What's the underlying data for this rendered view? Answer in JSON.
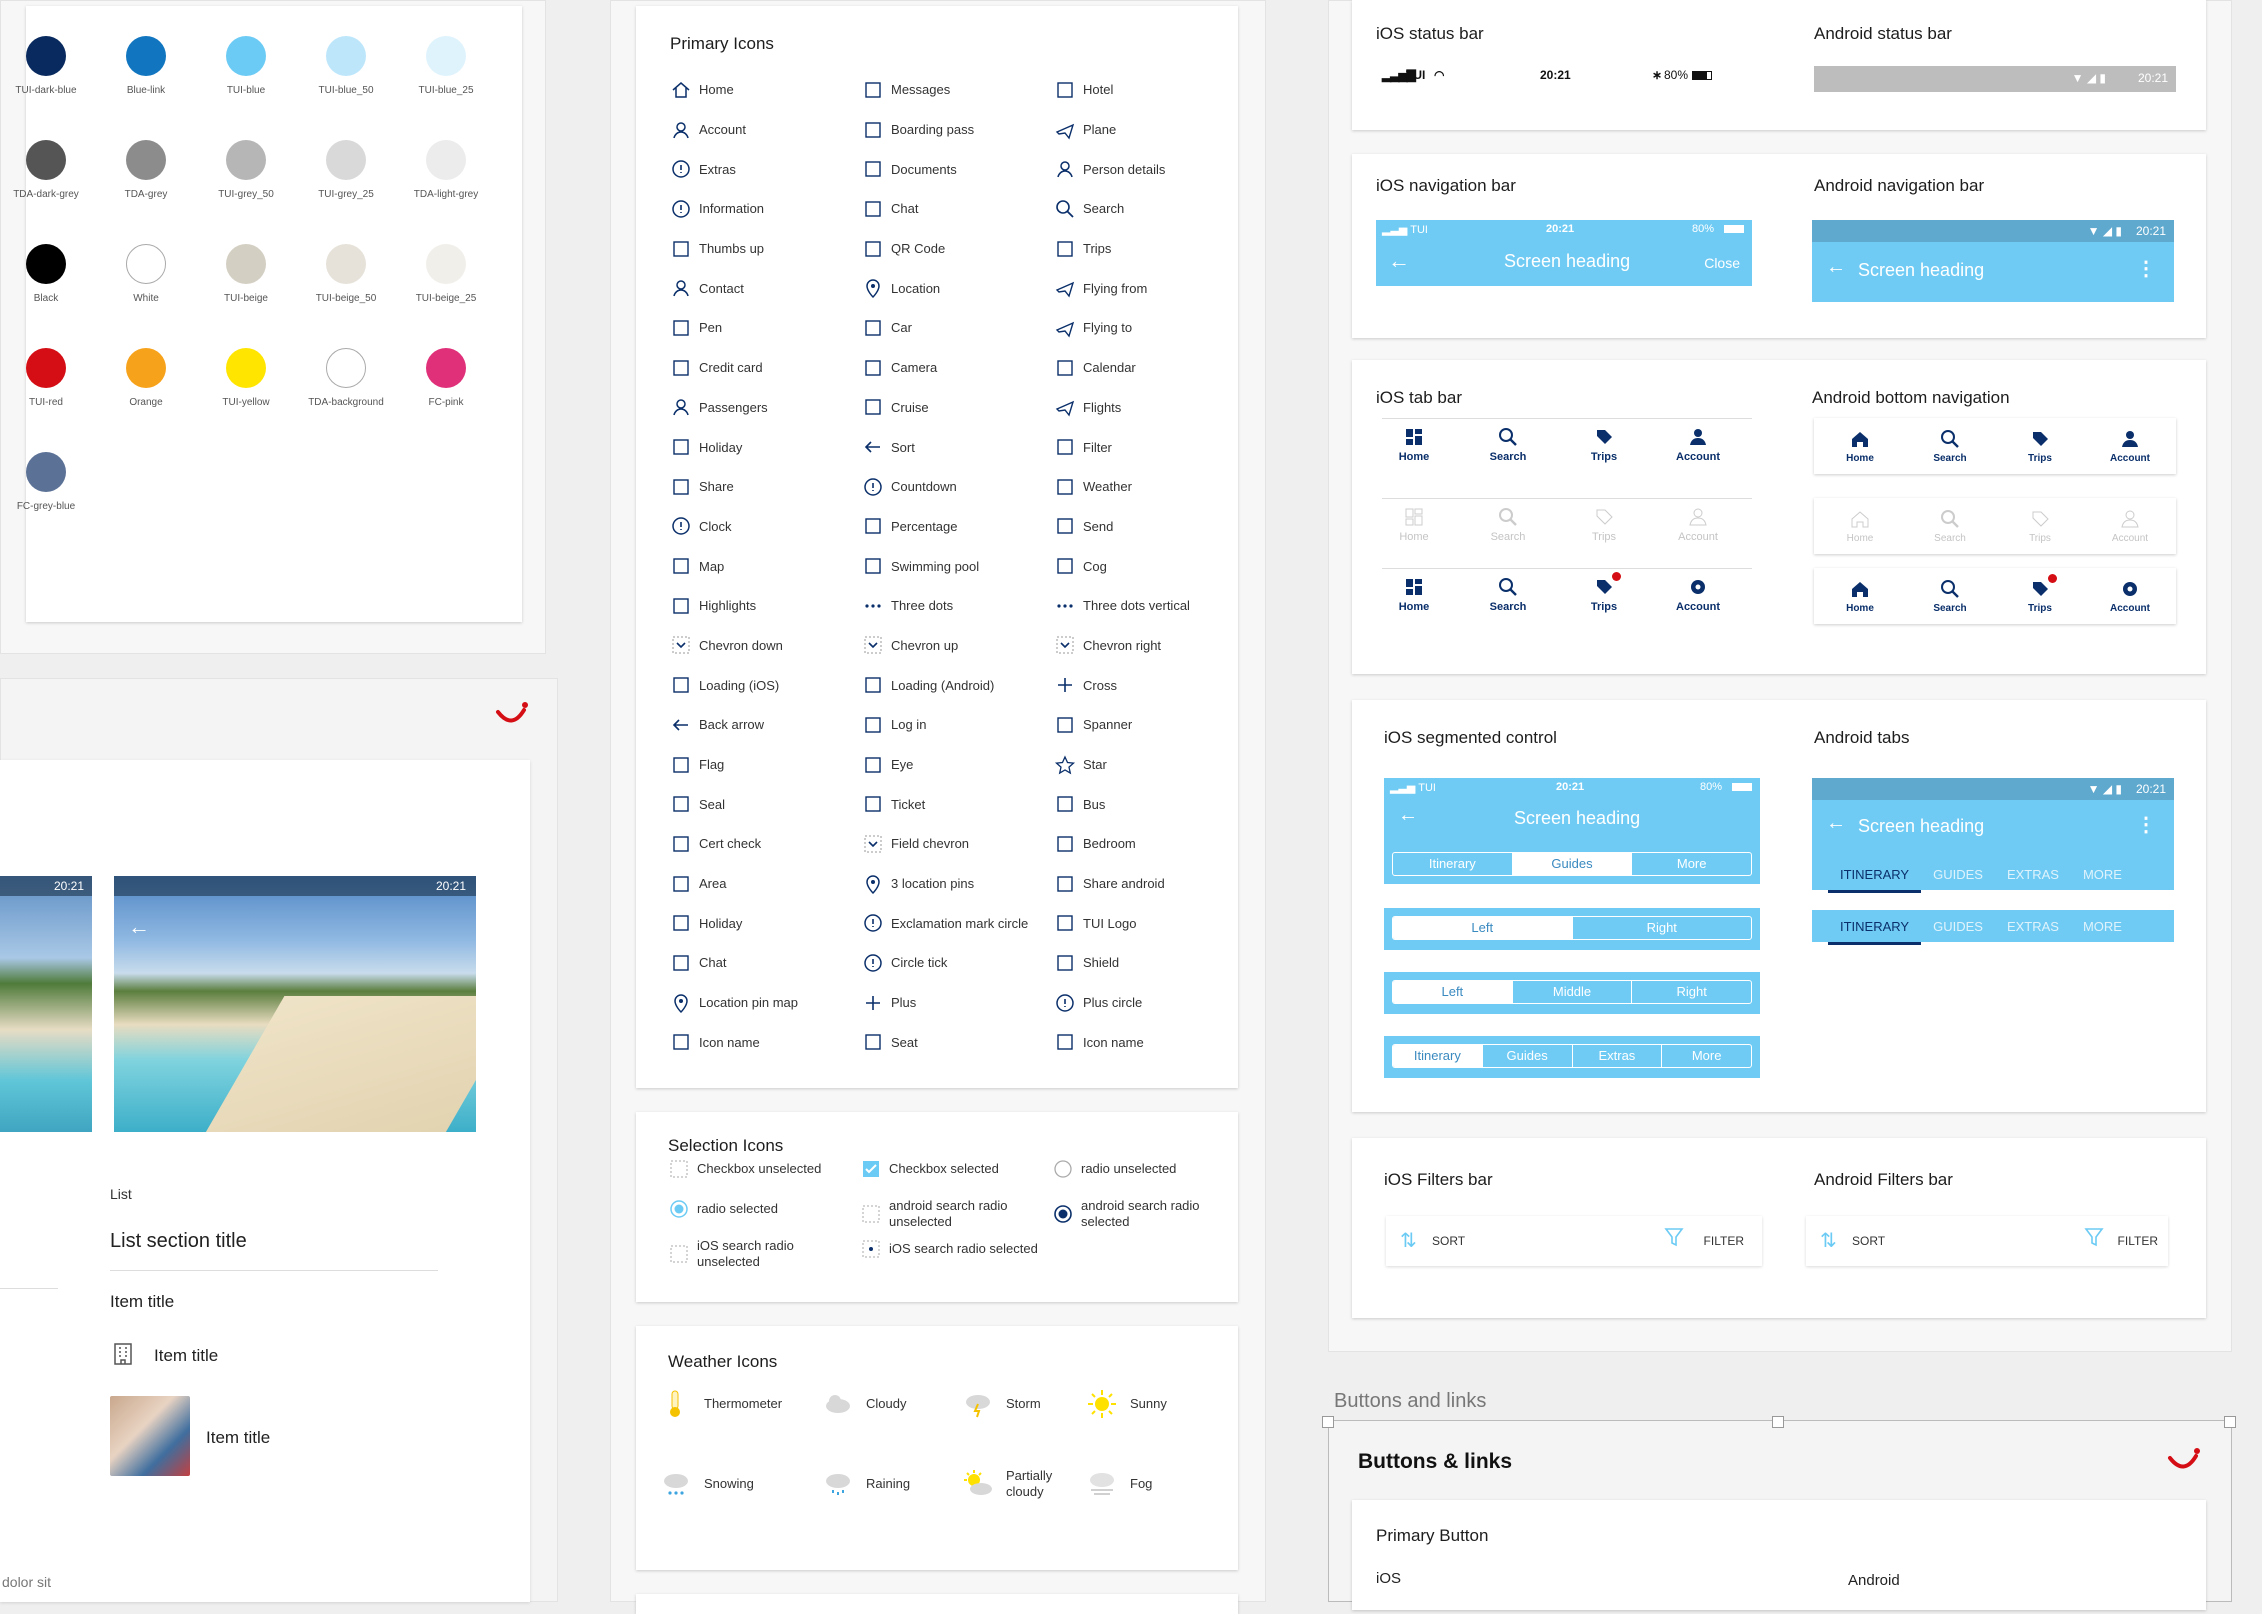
{
  "colors": [
    {
      "name": "TUI-dark-blue",
      "hex": "#092a5e"
    },
    {
      "name": "Blue-link",
      "hex": "#1176bf"
    },
    {
      "name": "TUI-blue",
      "hex": "#6ccbf4"
    },
    {
      "name": "TUI-blue_50",
      "hex": "#bde6fb"
    },
    {
      "name": "TUI-blue_25",
      "hex": "#dff3fd"
    },
    {
      "name": "TDA-dark-grey",
      "hex": "#555555"
    },
    {
      "name": "TDA-grey",
      "hex": "#8c8c8c"
    },
    {
      "name": "TUI-grey_50",
      "hex": "#b6b6b6"
    },
    {
      "name": "TUI-grey_25",
      "hex": "#d9d9d9"
    },
    {
      "name": "TDA-light-grey",
      "hex": "#ececec"
    },
    {
      "name": "Black",
      "hex": "#000000"
    },
    {
      "name": "White",
      "hex": "#ffffff"
    },
    {
      "name": "TUI-beige",
      "hex": "#d4cfc3"
    },
    {
      "name": "TUI-beige_50",
      "hex": "#e6e2d9"
    },
    {
      "name": "TUI-beige_25",
      "hex": "#f1efea"
    },
    {
      "name": "TUI-red",
      "hex": "#d40e14"
    },
    {
      "name": "Orange",
      "hex": "#f7a21b"
    },
    {
      "name": "TUI-yellow",
      "hex": "#ffe500"
    },
    {
      "name": "TDA-background",
      "hex": "#ffffff"
    },
    {
      "name": "FC-pink",
      "hex": "#e0307a"
    },
    {
      "name": "FC-grey-blue",
      "hex": "#5b7196"
    }
  ],
  "primary_icons": {
    "title": "Primary Icons",
    "col1": [
      "Home",
      "Account",
      "Extras",
      "Information",
      "Thumbs up",
      "Contact",
      "Pen",
      "Credit card",
      "Passengers",
      "Holiday",
      "Share",
      "Clock",
      "Map",
      "Highlights",
      "Chevron down",
      "Loading (iOS)",
      "Back arrow",
      "Flag",
      "Seal",
      "Cert check",
      "Area",
      "Holiday",
      "Chat",
      "Location pin map",
      "Icon name"
    ],
    "col2": [
      "Messages",
      "Boarding pass",
      "Documents",
      "Chat",
      "QR Code",
      "Location",
      "Car",
      "Camera",
      "Cruise",
      "Sort",
      "Countdown",
      "Percentage",
      "Swimming pool",
      "Three dots",
      "Chevron up",
      "Loading (Android)",
      "Log in",
      "Eye",
      "Ticket",
      "Field chevron",
      "3 location pins",
      "Exclamation mark circle",
      "Circle tick",
      "Plus",
      "Seat"
    ],
    "col3": [
      "Hotel",
      "Plane",
      "Person details",
      "Search",
      "Trips",
      "Flying from",
      "Flying to",
      "Calendar",
      "Flights",
      "Filter",
      "Weather",
      "Send",
      "Cog",
      "Three dots vertical",
      "Chevron right",
      "Cross",
      "Spanner",
      "Star",
      "Bus",
      "Bedroom",
      "Share android",
      "TUI Logo",
      "Shield",
      "Plus circle",
      "Icon name"
    ]
  },
  "selection_icons": {
    "title": "Selection Icons",
    "items": [
      "Checkbox unselected",
      "Checkbox selected",
      "radio unselected",
      "radio selected",
      "android search radio unselected",
      "android search radio selected",
      "iOS search radio unselected",
      "iOS search radio selected"
    ]
  },
  "weather_icons": {
    "title": "Weather Icons",
    "items": [
      "Thermometer",
      "Cloudy",
      "Storm",
      "Sunny",
      "Snowing",
      "Raining",
      "Partially cloudy",
      "Fog"
    ]
  },
  "left_preview": {
    "time1": "20:21",
    "time2": "20:21",
    "list_label": "List",
    "section_title": "List section title",
    "item1": "Item title",
    "item2": "Item title",
    "item3": "Item title",
    "footer": "dolor sit"
  },
  "status": {
    "ios_title": "iOS status bar",
    "android_title": "Android status bar",
    "carrier": "TUI",
    "time": "20:21",
    "battery": "80%"
  },
  "navbar": {
    "ios_title": "iOS navigation bar",
    "android_title": "Android navigation bar",
    "heading": "Screen heading",
    "close": "Close"
  },
  "tabbar": {
    "ios_title": "iOS tab bar",
    "android_title": "Android bottom navigation",
    "tabs": [
      "Home",
      "Search",
      "Trips",
      "Account"
    ]
  },
  "segmented": {
    "ios_title": "iOS segmented control",
    "android_title": "Android tabs",
    "seg1": [
      "Itinerary",
      "Guides",
      "More"
    ],
    "seg2": [
      "Left",
      "Right"
    ],
    "seg3": [
      "Left",
      "Middle",
      "Right"
    ],
    "seg4": [
      "Itinerary",
      "Guides",
      "Extras",
      "More"
    ],
    "atabs": [
      "ITINERARY",
      "GUIDES",
      "EXTRAS",
      "MORE"
    ]
  },
  "filters": {
    "ios_title": "iOS Filters bar",
    "android_title": "Android Filters bar",
    "sort": "SORT",
    "filter": "FILTER"
  },
  "buttons": {
    "section_label": "Buttons and links",
    "header": "Buttons & links",
    "primary": "Primary Button",
    "ios": "iOS",
    "android": "Android"
  }
}
